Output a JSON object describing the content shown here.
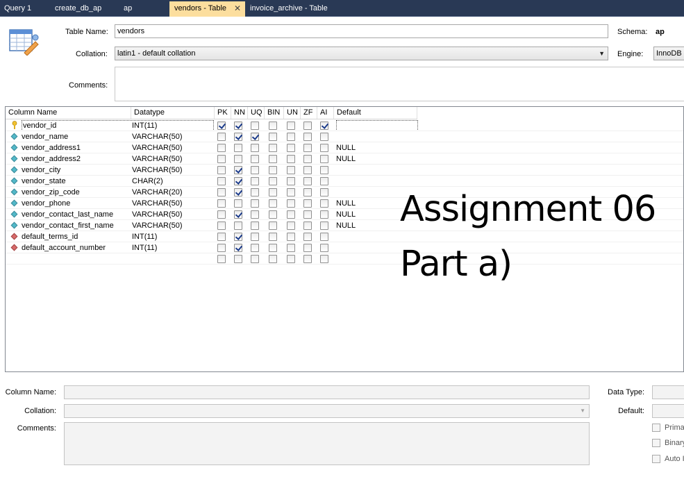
{
  "tabs": [
    {
      "label": "Query 1"
    },
    {
      "label": "create_db_ap"
    },
    {
      "label": "ap"
    },
    {
      "label": "vendors - Table",
      "active": true,
      "close": "✕"
    },
    {
      "label": "invoice_archive - Table"
    }
  ],
  "header": {
    "table_name_label": "Table Name:",
    "table_name_value": "vendors",
    "schema_label": "Schema:",
    "schema_value": "ap",
    "collation_label": "Collation:",
    "collation_value": "latin1 - default collation",
    "engine_label": "Engine:",
    "engine_value": "InnoDB",
    "comments_label": "Comments:",
    "icon": "table-edit-icon"
  },
  "grid": {
    "headers": {
      "name": "Column Name",
      "datatype": "Datatype",
      "pk": "PK",
      "nn": "NN",
      "uq": "UQ",
      "bin": "BIN",
      "un": "UN",
      "zf": "ZF",
      "ai": "AI",
      "default": "Default"
    },
    "rows": [
      {
        "name": "vendor_id",
        "type": "INT(11)",
        "icon": "primary-key-icon",
        "pk": true,
        "nn": true,
        "uq": false,
        "bin": false,
        "un": false,
        "zf": false,
        "ai": true,
        "default": ""
      },
      {
        "name": "vendor_name",
        "type": "VARCHAR(50)",
        "icon": "column-icon",
        "pk": false,
        "nn": true,
        "uq": true,
        "bin": false,
        "un": false,
        "zf": false,
        "ai": false,
        "default": ""
      },
      {
        "name": "vendor_address1",
        "type": "VARCHAR(50)",
        "icon": "column-icon",
        "pk": false,
        "nn": false,
        "uq": false,
        "bin": false,
        "un": false,
        "zf": false,
        "ai": false,
        "default": "NULL"
      },
      {
        "name": "vendor_address2",
        "type": "VARCHAR(50)",
        "icon": "column-icon",
        "pk": false,
        "nn": false,
        "uq": false,
        "bin": false,
        "un": false,
        "zf": false,
        "ai": false,
        "default": "NULL"
      },
      {
        "name": "vendor_city",
        "type": "VARCHAR(50)",
        "icon": "column-icon",
        "pk": false,
        "nn": true,
        "uq": false,
        "bin": false,
        "un": false,
        "zf": false,
        "ai": false,
        "default": ""
      },
      {
        "name": "vendor_state",
        "type": "CHAR(2)",
        "icon": "column-icon",
        "pk": false,
        "nn": true,
        "uq": false,
        "bin": false,
        "un": false,
        "zf": false,
        "ai": false,
        "default": ""
      },
      {
        "name": "vendor_zip_code",
        "type": "VARCHAR(20)",
        "icon": "column-icon",
        "pk": false,
        "nn": true,
        "uq": false,
        "bin": false,
        "un": false,
        "zf": false,
        "ai": false,
        "default": ""
      },
      {
        "name": "vendor_phone",
        "type": "VARCHAR(50)",
        "icon": "column-icon",
        "pk": false,
        "nn": false,
        "uq": false,
        "bin": false,
        "un": false,
        "zf": false,
        "ai": false,
        "default": "NULL"
      },
      {
        "name": "vendor_contact_last_name",
        "type": "VARCHAR(50)",
        "icon": "column-icon",
        "pk": false,
        "nn": true,
        "uq": false,
        "bin": false,
        "un": false,
        "zf": false,
        "ai": false,
        "default": "NULL"
      },
      {
        "name": "vendor_contact_first_name",
        "type": "VARCHAR(50)",
        "icon": "column-icon",
        "pk": false,
        "nn": false,
        "uq": false,
        "bin": false,
        "un": false,
        "zf": false,
        "ai": false,
        "default": "NULL"
      },
      {
        "name": "default_terms_id",
        "type": "INT(11)",
        "icon": "foreign-key-icon",
        "pk": false,
        "nn": true,
        "uq": false,
        "bin": false,
        "un": false,
        "zf": false,
        "ai": false,
        "default": ""
      },
      {
        "name": "default_account_number",
        "type": "INT(11)",
        "icon": "foreign-key-icon",
        "pk": false,
        "nn": true,
        "uq": false,
        "bin": false,
        "un": false,
        "zf": false,
        "ai": false,
        "default": ""
      },
      {
        "name": "",
        "type": "",
        "icon": "",
        "pk": false,
        "nn": false,
        "uq": false,
        "bin": false,
        "un": false,
        "zf": false,
        "ai": false,
        "default": ""
      }
    ]
  },
  "overlay": {
    "line1": "Assignment 06",
    "line2": "Part a)"
  },
  "details": {
    "column_name_label": "Column Name:",
    "collation_label": "Collation:",
    "comments_label": "Comments:",
    "data_type_label": "Data Type:",
    "default_label": "Default:",
    "primary_label": "Primar",
    "binary_label": "Binary",
    "auto_label": "Auto I"
  }
}
